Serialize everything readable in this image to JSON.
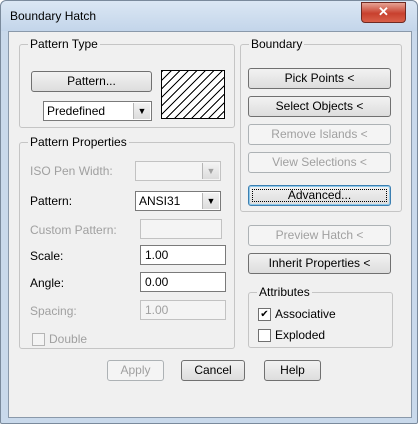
{
  "window": {
    "title": "Boundary Hatch",
    "close_glyph": "✕"
  },
  "pattern_type": {
    "legend": "Pattern Type",
    "pattern_button": "Pattern...",
    "type_select": "Predefined"
  },
  "pattern_properties": {
    "legend": "Pattern Properties",
    "iso_pen_width_label": "ISO Pen Width:",
    "iso_pen_width_value": "",
    "pattern_label": "Pattern:",
    "pattern_value": "ANSI31",
    "custom_pattern_label": "Custom Pattern:",
    "custom_pattern_value": "",
    "scale_label": "Scale:",
    "scale_value": "1.00",
    "angle_label": "Angle:",
    "angle_value": "0.00",
    "spacing_label": "Spacing:",
    "spacing_value": "1.00",
    "double_label": "Double"
  },
  "boundary": {
    "legend": "Boundary",
    "pick_points": "Pick Points <",
    "select_objects": "Select Objects <",
    "remove_islands": "Remove Islands <",
    "view_selections": "View Selections <",
    "advanced": "Advanced..."
  },
  "preview_hatch": "Preview Hatch <",
  "inherit_properties": "Inherit Properties <",
  "attributes": {
    "legend": "Attributes",
    "associative_label": "Associative",
    "associative_checked": true,
    "exploded_label": "Exploded",
    "exploded_checked": false
  },
  "footer": {
    "apply": "Apply",
    "cancel": "Cancel",
    "help": "Help"
  },
  "icons": {
    "dropdown": "▼",
    "checkmark": "✔"
  }
}
